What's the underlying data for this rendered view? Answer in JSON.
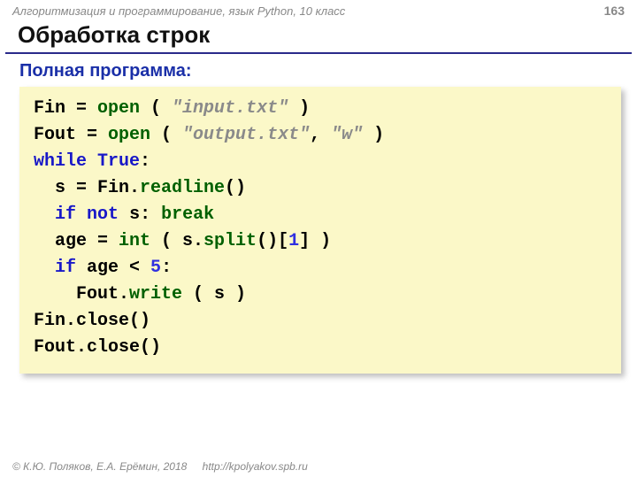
{
  "header": {
    "course": "Алгоритмизация и программирование, язык Python, 10 класс",
    "page": "163"
  },
  "title": "Обработка строк",
  "subtitle": "Полная программа:",
  "code": {
    "l1": {
      "a": "Fin = ",
      "b": "open",
      "c": " ( ",
      "d": "\"input.txt\"",
      "e": " )"
    },
    "l2": {
      "a": "Fout = ",
      "b": "open",
      "c": " ( ",
      "d": "\"output.txt\"",
      "e": ", ",
      "f": "\"w\"",
      "g": " )"
    },
    "l3": {
      "a": "while",
      "b": " ",
      "c": "True",
      "d": ":"
    },
    "l4": {
      "a": "  s = Fin.",
      "b": "readline",
      "c": "()"
    },
    "l5": {
      "a": "  ",
      "b": "if",
      "c": " ",
      "d": "not",
      "e": " s: ",
      "f": "break"
    },
    "l6": {
      "a": "  age = ",
      "b": "int",
      "c": " ( s.",
      "d": "split",
      "e": "()[",
      "f": "1",
      "g": "] )"
    },
    "l7": {
      "a": "  ",
      "b": "if",
      "c": " age < ",
      "d": "5",
      "e": ":"
    },
    "l8": {
      "a": "    Fout.",
      "b": "write",
      "c": " ( s )"
    },
    "l9": {
      "a": "Fin.close()"
    },
    "l10": {
      "a": "Fout.close()"
    }
  },
  "footer": {
    "copyright": "© К.Ю. Поляков, Е.А. Ерёмин, 2018",
    "url": "http://kpolyakov.spb.ru"
  }
}
